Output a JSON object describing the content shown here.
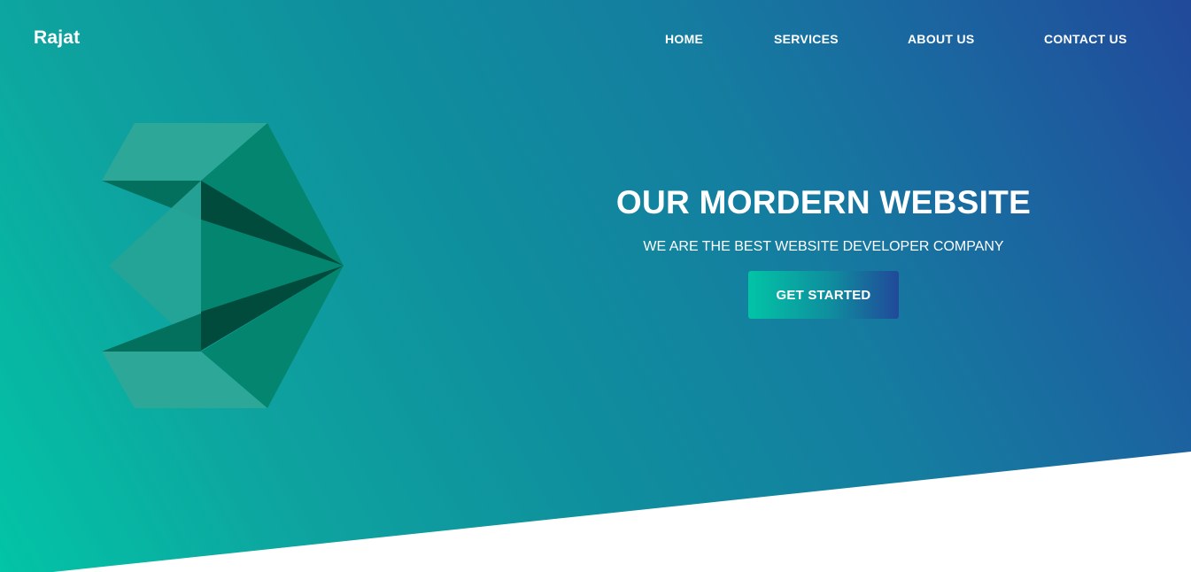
{
  "header": {
    "brand": "Rajat",
    "nav": [
      {
        "label": "HOME"
      },
      {
        "label": "SERVICES"
      },
      {
        "label": "ABOUT US"
      },
      {
        "label": "CONTACT US"
      }
    ]
  },
  "hero": {
    "title": "OUR MORDERN WEBSITE",
    "subtitle": "WE ARE THE BEST WEBSITE DEVELOPER COMPANY",
    "cta_label": "GET STARTED"
  },
  "colors": {
    "gradient_start": "#02c4a6",
    "gradient_mid": "#0f8d9e",
    "gradient_end": "#21499a",
    "logo_light": "#26a397",
    "logo_mid": "#048671",
    "logo_dark": "#004a3a",
    "text": "#ffffff"
  },
  "icons": {
    "hero_logo": "3d-polygon-logo-icon"
  }
}
